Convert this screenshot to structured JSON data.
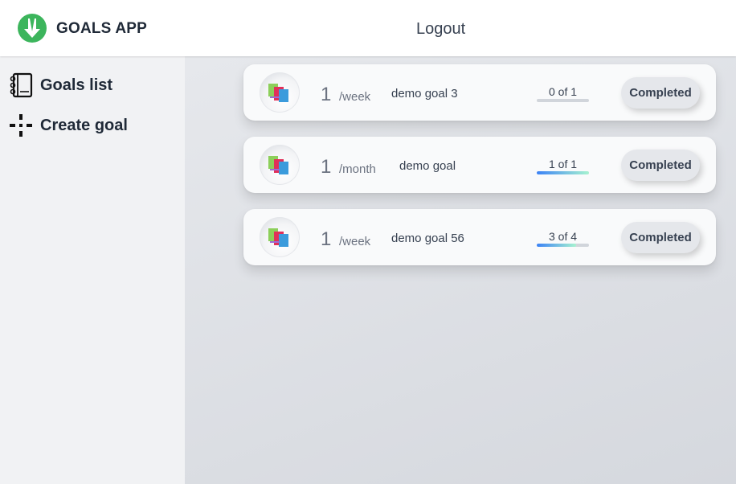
{
  "header": {
    "app_title": "GOALS APP",
    "logout_label": "Logout",
    "brand_color": "#3cb55c"
  },
  "sidebar": {
    "items": [
      {
        "label": "Goals list",
        "icon": "notebook-icon"
      },
      {
        "label": "Create goal",
        "icon": "add-cross-icon"
      }
    ]
  },
  "goals": [
    {
      "icon": "books-icon",
      "frequency": "1",
      "period": "/week",
      "name": "demo goal 3",
      "progress_text": "0 of 1",
      "progress": 0.0,
      "button": "Completed"
    },
    {
      "icon": "books-icon",
      "frequency": "1",
      "period": "/month",
      "name": "demo goal",
      "progress_text": "1 of 1",
      "progress": 1.0,
      "button": "Completed"
    },
    {
      "icon": "books-icon",
      "frequency": "1",
      "period": "/week",
      "name": "demo goal 56",
      "progress_text": "3 of 4",
      "progress": 0.75,
      "button": "Completed"
    }
  ]
}
